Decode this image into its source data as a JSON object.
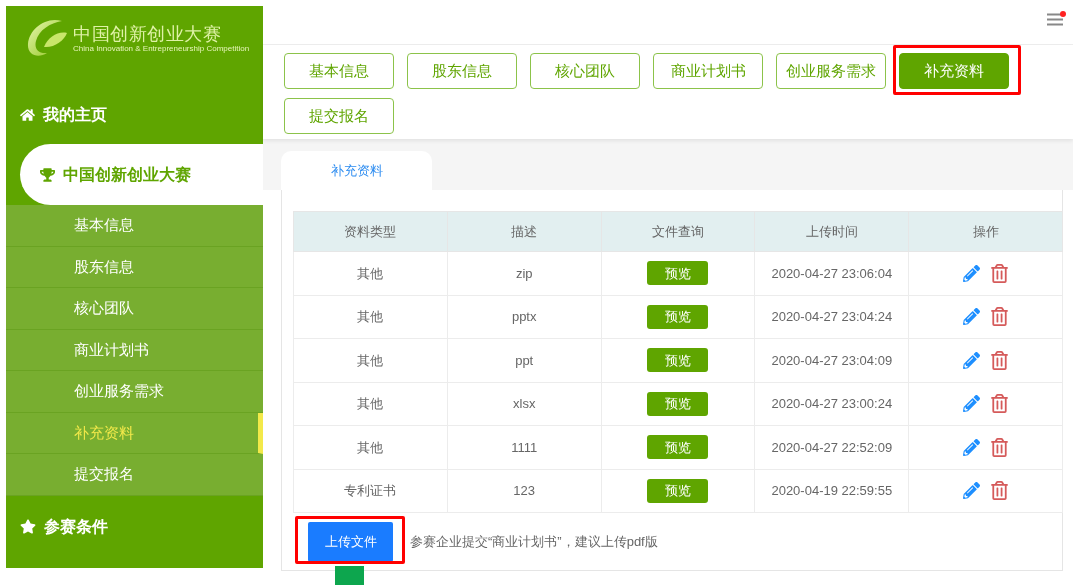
{
  "logo": {
    "title": "中国创新创业大赛",
    "subtitle": "China Innovation & Entrepreneurship Competition"
  },
  "header": {
    "menu_notification": true
  },
  "sidebar": {
    "home": {
      "label": "我的主页"
    },
    "competition": {
      "label": "中国创新创业大赛",
      "expanded": true,
      "items": [
        {
          "label": "基本信息",
          "selected": false
        },
        {
          "label": "股东信息",
          "selected": false
        },
        {
          "label": "核心团队",
          "selected": false
        },
        {
          "label": "商业计划书",
          "selected": false
        },
        {
          "label": "创业服务需求",
          "selected": false
        },
        {
          "label": "补充资料",
          "selected": true
        },
        {
          "label": "提交报名",
          "selected": false
        }
      ]
    },
    "conditions": {
      "label": "参赛条件"
    }
  },
  "step_tabs": [
    {
      "label": "基本信息",
      "selected": false,
      "highlighted": false
    },
    {
      "label": "股东信息",
      "selected": false,
      "highlighted": false
    },
    {
      "label": "核心团队",
      "selected": false,
      "highlighted": false
    },
    {
      "label": "商业计划书",
      "selected": false,
      "highlighted": false
    },
    {
      "label": "创业服务需求",
      "selected": false,
      "highlighted": false
    },
    {
      "label": "补充资料",
      "selected": true,
      "highlighted": true
    },
    {
      "label": "提交报名",
      "selected": false,
      "highlighted": false
    }
  ],
  "content_tabs": [
    {
      "label": "补充资料",
      "selected": true
    }
  ],
  "table": {
    "columns": [
      "资料类型",
      "描述",
      "文件查询",
      "上传时间",
      "操作"
    ],
    "rows": [
      {
        "type": "其他",
        "description": "zip",
        "preview": "预览",
        "uploaded_at": "2020-04-27 23:06:04"
      },
      {
        "type": "其他",
        "description": "pptx",
        "preview": "预览",
        "uploaded_at": "2020-04-27 23:04:24"
      },
      {
        "type": "其他",
        "description": "ppt",
        "preview": "预览",
        "uploaded_at": "2020-04-27 23:04:09"
      },
      {
        "type": "其他",
        "description": "xlsx",
        "preview": "预览",
        "uploaded_at": "2020-04-27 23:00:24"
      },
      {
        "type": "其他",
        "description": "1111",
        "preview": "预览",
        "uploaded_at": "2020-04-27 22:52:09"
      },
      {
        "type": "专利证书",
        "description": "123",
        "preview": "预览",
        "uploaded_at": "2020-04-19 22:59:55"
      }
    ]
  },
  "upload": {
    "button": "上传文件",
    "highlighted": true,
    "note": "参赛企业提交“商业计划书”，建议上传pdf版"
  }
}
